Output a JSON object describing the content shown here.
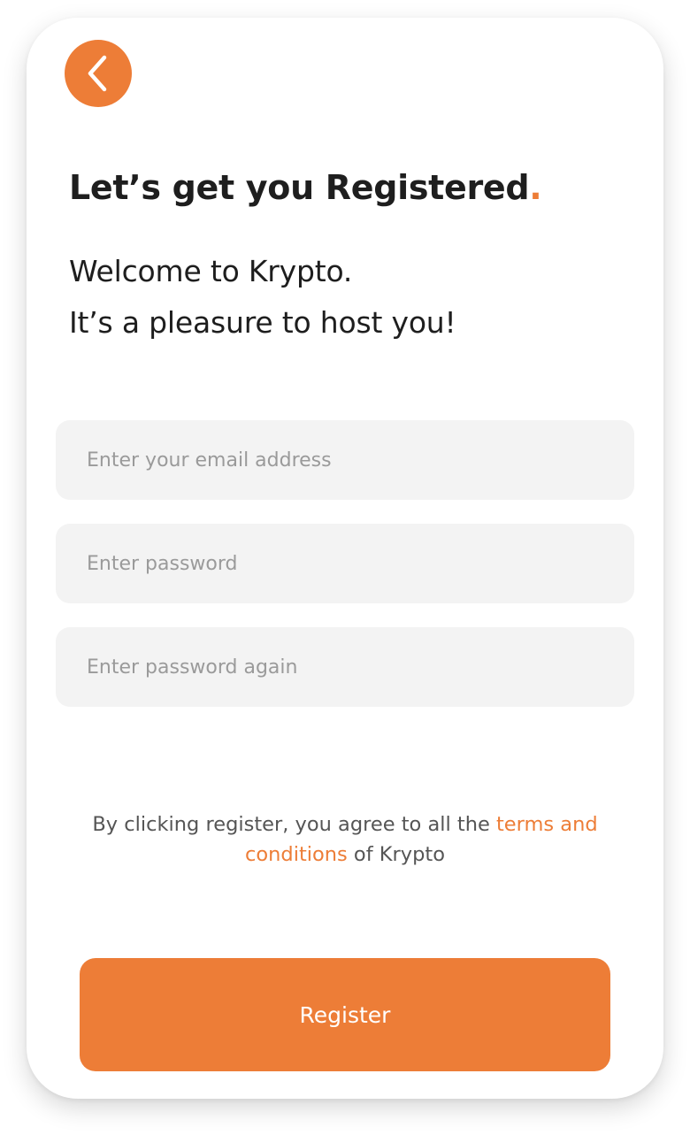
{
  "header": {
    "back_icon": "chevron-left-icon",
    "title": "Let’s get you Registered",
    "title_accent": "."
  },
  "welcome": {
    "line1": "Welcome to Krypto.",
    "line2": "It’s a pleasure to host you!"
  },
  "form": {
    "email_placeholder": "Enter your email address",
    "email_value": "",
    "password_placeholder": "Enter password",
    "password_value": "",
    "password_again_placeholder": "Enter password again",
    "password_again_value": ""
  },
  "terms": {
    "prefix": "By clicking register, you agree to all the ",
    "link": "terms and conditions",
    "suffix": " of Krypto"
  },
  "actions": {
    "register_label": "Register"
  },
  "colors": {
    "accent": "#ED7D37",
    "field_bg": "#F3F3F3",
    "text_dark": "#1E1E1E"
  }
}
